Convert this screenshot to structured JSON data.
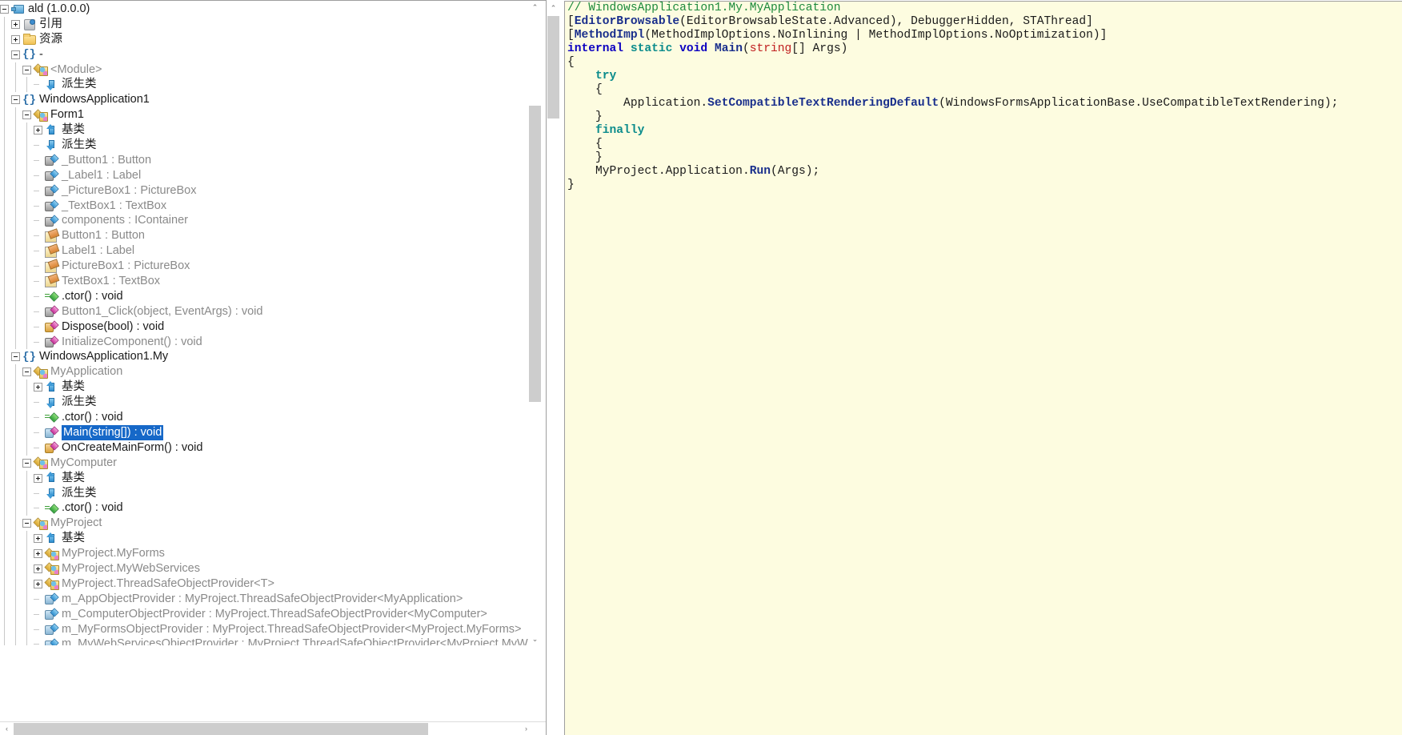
{
  "tree": {
    "scrollbars": {
      "v_up_glyph": "⌃",
      "v_down_glyph": "⌄",
      "h_left_glyph": "‹",
      "h_right_glyph": "›"
    },
    "nodes": [
      {
        "label": "ald (1.0.0.0)",
        "depth": 0,
        "icon": "assembly",
        "expander": "minus",
        "dark": true,
        "selected": false
      },
      {
        "label": "引用",
        "depth": 1,
        "icon": "ref",
        "expander": "plus",
        "dark": true,
        "selected": false
      },
      {
        "label": "资源",
        "depth": 1,
        "icon": "folder",
        "expander": "plus",
        "dark": true,
        "selected": false
      },
      {
        "label": "-",
        "depth": 1,
        "icon": "ns",
        "expander": "minus",
        "dark": true,
        "selected": false
      },
      {
        "label": "<Module>",
        "depth": 2,
        "icon": "class",
        "expander": "minus",
        "dark": false,
        "selected": false
      },
      {
        "label": "派生类",
        "depth": 3,
        "icon": "derived",
        "expander": "none",
        "dark": true,
        "selected": false
      },
      {
        "label": "WindowsApplication1",
        "depth": 1,
        "icon": "ns",
        "expander": "minus",
        "dark": true,
        "selected": false
      },
      {
        "label": "Form1",
        "depth": 2,
        "icon": "class",
        "expander": "minus",
        "dark": true,
        "selected": false
      },
      {
        "label": "基类",
        "depth": 3,
        "icon": "base",
        "expander": "plus",
        "dark": true,
        "selected": false
      },
      {
        "label": "派生类",
        "depth": 3,
        "icon": "derived",
        "expander": "none",
        "dark": true,
        "selected": false
      },
      {
        "label": "_Button1 : Button",
        "depth": 3,
        "icon": "field",
        "expander": "none",
        "dark": false,
        "selected": false
      },
      {
        "label": "_Label1 : Label",
        "depth": 3,
        "icon": "field",
        "expander": "none",
        "dark": false,
        "selected": false
      },
      {
        "label": "_PictureBox1 : PictureBox",
        "depth": 3,
        "icon": "field",
        "expander": "none",
        "dark": false,
        "selected": false
      },
      {
        "label": "_TextBox1 : TextBox",
        "depth": 3,
        "icon": "field",
        "expander": "none",
        "dark": false,
        "selected": false
      },
      {
        "label": "components : IContainer",
        "depth": 3,
        "icon": "field",
        "expander": "none",
        "dark": false,
        "selected": false
      },
      {
        "label": "Button1 : Button",
        "depth": 3,
        "icon": "prop",
        "expander": "none",
        "dark": false,
        "selected": false
      },
      {
        "label": "Label1 : Label",
        "depth": 3,
        "icon": "prop",
        "expander": "none",
        "dark": false,
        "selected": false
      },
      {
        "label": "PictureBox1 : PictureBox",
        "depth": 3,
        "icon": "prop",
        "expander": "none",
        "dark": false,
        "selected": false
      },
      {
        "label": "TextBox1 : TextBox",
        "depth": 3,
        "icon": "prop",
        "expander": "none",
        "dark": false,
        "selected": false
      },
      {
        "label": ".ctor() : void",
        "depth": 3,
        "icon": "ctor",
        "expander": "none",
        "dark": true,
        "selected": false
      },
      {
        "label": "Button1_Click(object, EventArgs) : void",
        "depth": 3,
        "icon": "method",
        "expander": "none",
        "dark": false,
        "selected": false
      },
      {
        "label": "Dispose(bool) : void",
        "depth": 3,
        "icon": "method-o",
        "expander": "none",
        "dark": true,
        "selected": false
      },
      {
        "label": "InitializeComponent() : void",
        "depth": 3,
        "icon": "method",
        "expander": "none",
        "dark": false,
        "selected": false
      },
      {
        "label": "WindowsApplication1.My",
        "depth": 1,
        "icon": "ns",
        "expander": "minus",
        "dark": true,
        "selected": false
      },
      {
        "label": "MyApplication",
        "depth": 2,
        "icon": "class",
        "expander": "minus",
        "dark": false,
        "selected": false
      },
      {
        "label": "基类",
        "depth": 3,
        "icon": "base",
        "expander": "plus",
        "dark": true,
        "selected": false
      },
      {
        "label": "派生类",
        "depth": 3,
        "icon": "derived",
        "expander": "none",
        "dark": true,
        "selected": false
      },
      {
        "label": ".ctor() : void",
        "depth": 3,
        "icon": "ctor",
        "expander": "none",
        "dark": true,
        "selected": false
      },
      {
        "label": "Main(string[]) : void",
        "depth": 3,
        "icon": "method-s",
        "expander": "none",
        "dark": true,
        "selected": true
      },
      {
        "label": "OnCreateMainForm() : void",
        "depth": 3,
        "icon": "method-o",
        "expander": "none",
        "dark": true,
        "selected": false
      },
      {
        "label": "MyComputer",
        "depth": 2,
        "icon": "class",
        "expander": "minus",
        "dark": false,
        "selected": false
      },
      {
        "label": "基类",
        "depth": 3,
        "icon": "base",
        "expander": "plus",
        "dark": true,
        "selected": false
      },
      {
        "label": "派生类",
        "depth": 3,
        "icon": "derived",
        "expander": "none",
        "dark": true,
        "selected": false
      },
      {
        "label": ".ctor() : void",
        "depth": 3,
        "icon": "ctor",
        "expander": "none",
        "dark": true,
        "selected": false
      },
      {
        "label": "MyProject",
        "depth": 2,
        "icon": "class",
        "expander": "minus",
        "dark": false,
        "selected": false
      },
      {
        "label": "基类",
        "depth": 3,
        "icon": "base",
        "expander": "plus",
        "dark": true,
        "selected": false
      },
      {
        "label": "MyProject.MyForms",
        "depth": 3,
        "icon": "class",
        "expander": "plus",
        "dark": false,
        "selected": false
      },
      {
        "label": "MyProject.MyWebServices",
        "depth": 3,
        "icon": "class",
        "expander": "plus",
        "dark": false,
        "selected": false
      },
      {
        "label": "MyProject.ThreadSafeObjectProvider<T>",
        "depth": 3,
        "icon": "class",
        "expander": "plus",
        "dark": false,
        "selected": false
      },
      {
        "label": "m_AppObjectProvider : MyProject.ThreadSafeObjectProvider<MyApplication>",
        "depth": 3,
        "icon": "field-s",
        "expander": "none",
        "dark": false,
        "selected": false
      },
      {
        "label": "m_ComputerObjectProvider : MyProject.ThreadSafeObjectProvider<MyComputer>",
        "depth": 3,
        "icon": "field-s",
        "expander": "none",
        "dark": false,
        "selected": false
      },
      {
        "label": "m_MyFormsObjectProvider : MyProject.ThreadSafeObjectProvider<MyProject.MyForms>",
        "depth": 3,
        "icon": "field-s",
        "expander": "none",
        "dark": false,
        "selected": false
      },
      {
        "label": "m_MyWebServicesObjectProvider : MyProject.ThreadSafeObjectProvider<MyProject.MyWebServices>",
        "depth": 3,
        "icon": "field-s",
        "expander": "none",
        "dark": false,
        "selected": false
      }
    ]
  },
  "code": {
    "scrollbars": {
      "v_up_glyph": "⌃"
    },
    "lines": [
      {
        "tokens": [
          {
            "t": "// WindowsApplication1.My.MyApplication",
            "c": "c-comment"
          }
        ]
      },
      {
        "tokens": [
          {
            "t": "[",
            "c": "c-plain"
          },
          {
            "t": "EditorBrowsable",
            "c": "c-method"
          },
          {
            "t": "(EditorBrowsableState.Advanced), DebuggerHidden, STAThread]",
            "c": "c-plain"
          }
        ]
      },
      {
        "tokens": [
          {
            "t": "[",
            "c": "c-plain"
          },
          {
            "t": "MethodImpl",
            "c": "c-method"
          },
          {
            "t": "(MethodImplOptions.NoInlining | MethodImplOptions.NoOptimization)]",
            "c": "c-plain"
          }
        ]
      },
      {
        "tokens": [
          {
            "t": "internal",
            "c": "c-kw"
          },
          {
            "t": " ",
            "c": "c-plain"
          },
          {
            "t": "static",
            "c": "c-kw2"
          },
          {
            "t": " ",
            "c": "c-plain"
          },
          {
            "t": "void",
            "c": "c-kw"
          },
          {
            "t": " ",
            "c": "c-plain"
          },
          {
            "t": "Main",
            "c": "c-method"
          },
          {
            "t": "(",
            "c": "c-plain"
          },
          {
            "t": "string",
            "c": "c-str"
          },
          {
            "t": "[] Args)",
            "c": "c-plain"
          }
        ]
      },
      {
        "tokens": [
          {
            "t": "{",
            "c": "c-plain"
          }
        ]
      },
      {
        "tokens": [
          {
            "t": "    ",
            "c": "c-plain"
          },
          {
            "t": "try",
            "c": "c-kw2"
          }
        ]
      },
      {
        "tokens": [
          {
            "t": "    {",
            "c": "c-plain"
          }
        ]
      },
      {
        "tokens": [
          {
            "t": "        Application.",
            "c": "c-plain"
          },
          {
            "t": "SetCompatibleTextRenderingDefault",
            "c": "c-method"
          },
          {
            "t": "(WindowsFormsApplicationBase.UseCompatibleTextRendering);",
            "c": "c-plain"
          }
        ]
      },
      {
        "tokens": [
          {
            "t": "    }",
            "c": "c-plain"
          }
        ]
      },
      {
        "tokens": [
          {
            "t": "    ",
            "c": "c-plain"
          },
          {
            "t": "finally",
            "c": "c-kw2"
          }
        ]
      },
      {
        "tokens": [
          {
            "t": "    {",
            "c": "c-plain"
          }
        ]
      },
      {
        "tokens": [
          {
            "t": "    }",
            "c": "c-plain"
          }
        ]
      },
      {
        "tokens": [
          {
            "t": "    MyProject.Application.",
            "c": "c-plain"
          },
          {
            "t": "Run",
            "c": "c-method"
          },
          {
            "t": "(Args);",
            "c": "c-plain"
          }
        ]
      },
      {
        "tokens": [
          {
            "t": "}",
            "c": "c-plain"
          }
        ]
      }
    ]
  }
}
